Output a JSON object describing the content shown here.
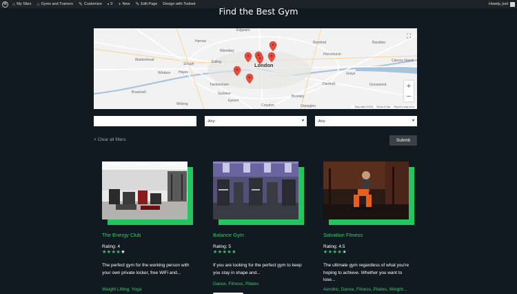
{
  "adminbar": {
    "items": [
      {
        "label": "My Sites",
        "icon": "home-icon"
      },
      {
        "label": "Gyms and Trainers",
        "icon": "home-icon"
      },
      {
        "label": "Customize",
        "icon": "brush-icon"
      },
      {
        "label": "0",
        "icon": "comment-icon"
      },
      {
        "label": "New",
        "icon": "plus-icon"
      },
      {
        "label": "Edit Page",
        "icon": "pencil-icon"
      },
      {
        "label": "Design with Toolset",
        "icon": ""
      }
    ],
    "greeting": "Howdy, joel"
  },
  "page": {
    "title": "Find the Best Gym"
  },
  "map": {
    "places": [
      {
        "label": "Edgware",
        "type": "town"
      },
      {
        "label": "Harrow",
        "type": "town"
      },
      {
        "label": "Wembley",
        "type": "town"
      },
      {
        "label": "Romford",
        "type": "town"
      },
      {
        "label": "Basildon",
        "type": "town"
      },
      {
        "label": "Hornchurch",
        "type": "town"
      },
      {
        "label": "Grays",
        "type": "town"
      },
      {
        "label": "Slough",
        "type": "town"
      },
      {
        "label": "Maidenhead",
        "type": "town"
      },
      {
        "label": "Windsor",
        "type": "town"
      },
      {
        "label": "London",
        "type": "city"
      },
      {
        "label": "Twickenham",
        "type": "town"
      },
      {
        "label": "Dartford",
        "type": "town"
      },
      {
        "label": "Gravesend",
        "type": "town"
      },
      {
        "label": "Bracknell",
        "type": "town"
      },
      {
        "label": "Woking",
        "type": "town"
      },
      {
        "label": "Croydon",
        "type": "town"
      },
      {
        "label": "Bromley",
        "type": "town"
      },
      {
        "label": "Orpington",
        "type": "town"
      },
      {
        "label": "Canvey Island",
        "type": "town"
      },
      {
        "label": "Ealing",
        "type": "town"
      },
      {
        "label": "Hayes",
        "type": "town"
      },
      {
        "label": "Epsom",
        "type": "town"
      },
      {
        "label": "Surbiton",
        "type": "town"
      }
    ],
    "attribution": [
      "Map data ©2018",
      "Terms of Use",
      "Report a map error"
    ]
  },
  "filters": {
    "select1": "-Any-",
    "select2": "-Any-",
    "clear_label": "× Clear all filters",
    "submit_label": "Submit"
  },
  "gyms": [
    {
      "name": "The Energy Club",
      "rating_text": "Rating: 4",
      "rating": 4,
      "description": "The perfect gym for the working person with your own private locker, free WiFi and...",
      "tags": "Weight Lifting, Yoga"
    },
    {
      "name": "Balance Gym",
      "rating_text": "Rating: 5",
      "rating": 5,
      "description": "If you are looking for the perfect gym to keep you stay in shape and...",
      "tags": "Dance, Fitness, Pilates"
    },
    {
      "name": "Salvation Fitness",
      "rating_text": "Rating: 4.5",
      "rating": 4.5,
      "description": "The ultimate gym regardless of what you're hoping to achieve. Whether you want to lose...",
      "tags": "Aerobic, Dance, Fitness, Pilates, Weight..."
    }
  ],
  "colors": {
    "accent_green": "#22c55e",
    "link_green": "#3ec66d",
    "background": "#121a21",
    "pin_red": "#e74c3c"
  }
}
